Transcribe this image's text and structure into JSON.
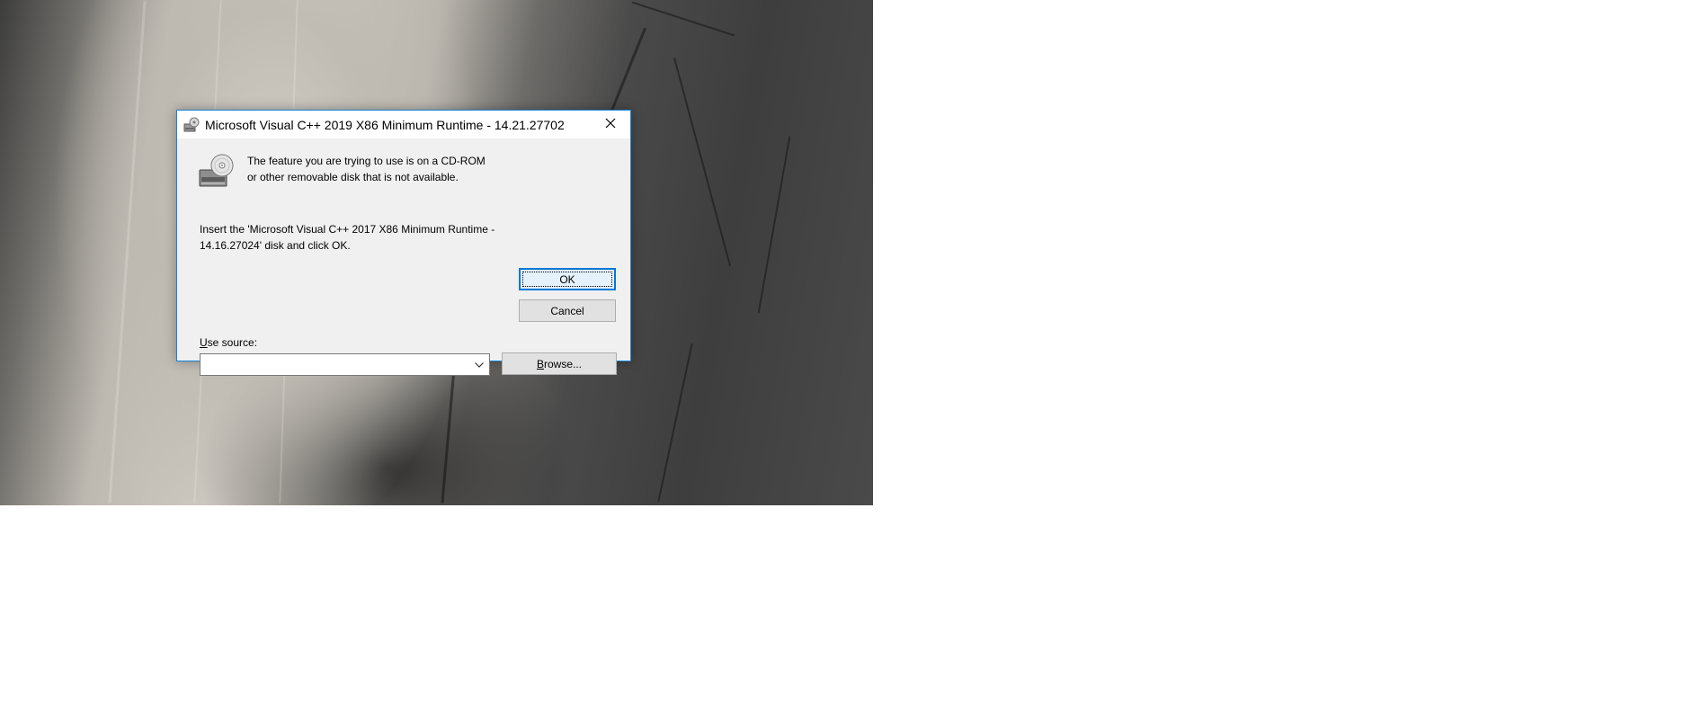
{
  "dialog": {
    "title": "Microsoft Visual C++ 2019 X86 Minimum Runtime - 14.21.27702",
    "icons": {
      "title": "installer-icon",
      "close": "close-icon",
      "message": "cd-rom-icon",
      "dropdown": "chevron-down-icon"
    },
    "message_line": "The feature you are trying to use is on a CD-ROM or other removable disk that is not available.",
    "instruction": "Insert the 'Microsoft Visual C++ 2017 X86 Minimum Runtime - 14.16.27024' disk and click OK.",
    "ok_label": "OK",
    "cancel_label": "Cancel",
    "use_source": {
      "label_mnemonic": "U",
      "label_rest": "se source:",
      "value": ""
    },
    "browse": {
      "label_mnemonic": "B",
      "label_rest": "rowse..."
    }
  },
  "colors": {
    "accent": "#0078d7",
    "window_border": "#1883d7",
    "dialog_bg": "#f0f0f0",
    "button_bg": "#e1e1e1"
  }
}
